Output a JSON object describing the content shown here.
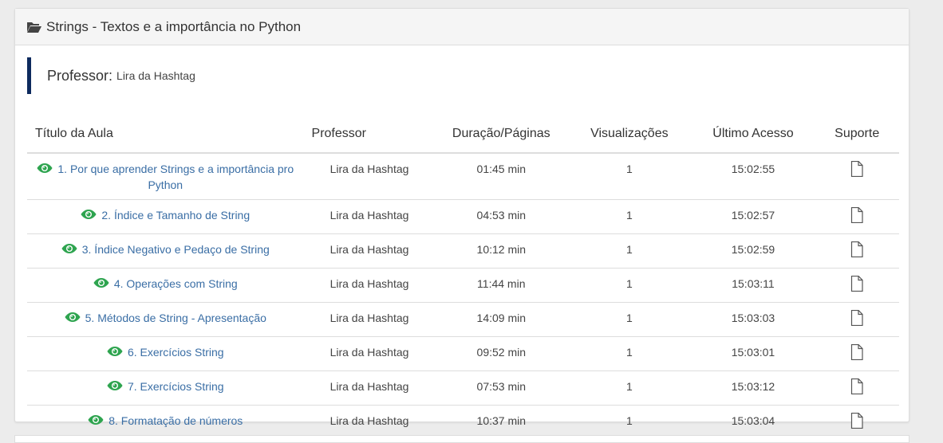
{
  "module": {
    "title": "Strings - Textos e a importância no Python",
    "header_icon": "folder-open-icon"
  },
  "teacher": {
    "label": "Professor:",
    "name": "Lira da Hashtag"
  },
  "table": {
    "headers": {
      "title": "Título da Aula",
      "professor": "Professor",
      "duration": "Duração/Páginas",
      "views": "Visualizações",
      "last_access": "Último Acesso",
      "support": "Suporte"
    },
    "rows": [
      {
        "title": "1. Por que aprender Strings e a importância pro Python",
        "professor": "Lira da Hashtag",
        "duration": "01:45 min",
        "views": "1",
        "last_access": "15:02:55",
        "support_icon": "file-icon"
      },
      {
        "title": "2. Índice e Tamanho de String",
        "professor": "Lira da Hashtag",
        "duration": "04:53 min",
        "views": "1",
        "last_access": "15:02:57",
        "support_icon": "file-icon"
      },
      {
        "title": "3. Índice Negativo e Pedaço de String",
        "professor": "Lira da Hashtag",
        "duration": "10:12 min",
        "views": "1",
        "last_access": "15:02:59",
        "support_icon": "file-icon"
      },
      {
        "title": "4. Operações com String",
        "professor": "Lira da Hashtag",
        "duration": "11:44 min",
        "views": "1",
        "last_access": "15:03:11",
        "support_icon": "file-icon"
      },
      {
        "title": "5. Métodos de String - Apresentação",
        "professor": "Lira da Hashtag",
        "duration": "14:09 min",
        "views": "1",
        "last_access": "15:03:03",
        "support_icon": "file-icon"
      },
      {
        "title": "6. Exercícios String",
        "professor": "Lira da Hashtag",
        "duration": "09:52 min",
        "views": "1",
        "last_access": "15:03:01",
        "support_icon": "file-icon"
      },
      {
        "title": "7. Exercícios String",
        "professor": "Lira da Hashtag",
        "duration": "07:53 min",
        "views": "1",
        "last_access": "15:03:12",
        "support_icon": "file-icon"
      },
      {
        "title": "8. Formatação de números",
        "professor": "Lira da Hashtag",
        "duration": "10:37 min",
        "views": "1",
        "last_access": "15:03:04",
        "support_icon": "file-icon"
      }
    ]
  },
  "colors": {
    "link": "#3a6ea5",
    "eye_watched": "#2ea44f",
    "teacher_accent": "#0d2a5e",
    "page_bg": "#ececec"
  }
}
